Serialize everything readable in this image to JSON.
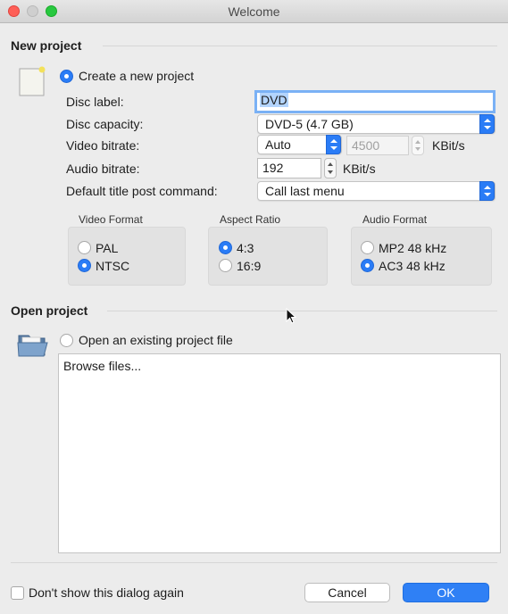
{
  "window": {
    "title": "Welcome"
  },
  "new_project": {
    "section_title": "New project",
    "create_label": "Create a new project",
    "fields": {
      "disc_label": {
        "label": "Disc label:",
        "value": "DVD"
      },
      "disc_capacity": {
        "label": "Disc capacity:",
        "value": "DVD-5 (4.7 GB)"
      },
      "video_bitrate": {
        "label": "Video bitrate:",
        "mode": "Auto",
        "value": "4500",
        "unit": "KBit/s"
      },
      "audio_bitrate": {
        "label": "Audio bitrate:",
        "value": "192",
        "unit": "KBit/s"
      },
      "post_command": {
        "label": "Default title post command:",
        "value": "Call last menu"
      }
    },
    "video_format": {
      "heading": "Video Format",
      "options": [
        "PAL",
        "NTSC"
      ],
      "selected": "NTSC"
    },
    "aspect_ratio": {
      "heading": "Aspect Ratio",
      "options": [
        "4:3",
        "16:9"
      ],
      "selected": "4:3"
    },
    "audio_format": {
      "heading": "Audio Format",
      "options": [
        "MP2 48 kHz",
        "AC3 48 kHz"
      ],
      "selected": "AC3 48 kHz"
    }
  },
  "open_project": {
    "section_title": "Open project",
    "open_label": "Open an existing project file",
    "browse_label": "Browse files..."
  },
  "footer": {
    "dont_show_label": "Don't show this dialog again",
    "cancel_label": "Cancel",
    "ok_label": "OK"
  },
  "colors": {
    "accent": "#2a7cf6",
    "focus_ring": "#7ab1f5",
    "selection": "#b3d4fd"
  }
}
